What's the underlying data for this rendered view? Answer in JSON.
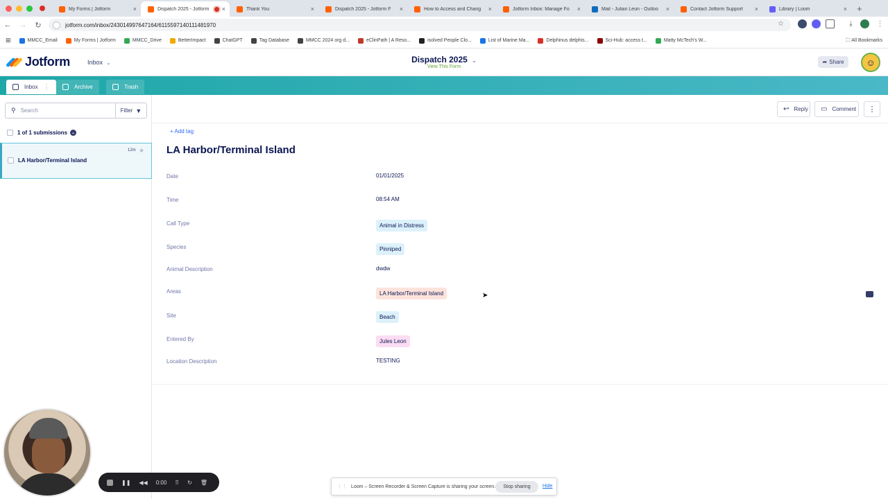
{
  "browser": {
    "tabs": [
      {
        "title": "My Forms | Jotform",
        "color": "#ff6100",
        "active": false
      },
      {
        "title": "Dispatch 2025 - Jotform",
        "color": "#ff6100",
        "active": true
      },
      {
        "title": "Thank You",
        "color": "#ff6100",
        "active": false
      },
      {
        "title": "Dispatch 2025 - Jotform F",
        "color": "#ff6100",
        "active": false
      },
      {
        "title": "How to Access and Chang",
        "color": "#ff6100",
        "active": false
      },
      {
        "title": "Jotform Inbox: Manage Fo",
        "color": "#ff6100",
        "active": false
      },
      {
        "title": "Mail - Julian Leon - Outloo",
        "color": "#0f6cbd",
        "active": false
      },
      {
        "title": "Contact Jotform Support",
        "color": "#ff6100",
        "active": false
      },
      {
        "title": "Library | Loom",
        "color": "#625df5",
        "active": false
      }
    ],
    "url": "jotform.com/inbox/243014997647164/6115597140111481970",
    "bookmarks": [
      {
        "label": "MMCC_Email",
        "color": "#1a73e8"
      },
      {
        "label": "My Forms | Jotform",
        "color": "#ff6100"
      },
      {
        "label": "MMCC_Drive",
        "color": "#34a853"
      },
      {
        "label": "BetterImpact",
        "color": "#f2a900"
      },
      {
        "label": "ChatGPT",
        "color": "#444"
      },
      {
        "label": "Tag Database",
        "color": "#444"
      },
      {
        "label": "MMCC 2024 org d...",
        "color": "#444"
      },
      {
        "label": "eClinPath | A Reso...",
        "color": "#c0392b"
      },
      {
        "label": "isolved People Clo...",
        "color": "#222"
      },
      {
        "label": "List of Marine Ma...",
        "color": "#1a73e8"
      },
      {
        "label": "Delphinus delphis...",
        "color": "#d93025"
      },
      {
        "label": "Sci-Hub: access t...",
        "color": "#8b0000"
      },
      {
        "label": "Matty McTech's W...",
        "color": "#34a853"
      }
    ],
    "all_bookmarks": "All Bookmarks"
  },
  "header": {
    "logo": "Jotform",
    "inbox_dropdown": "Inbox",
    "form_title": "Dispatch 2025",
    "form_link": "View This Form",
    "share": "Share"
  },
  "tabs": {
    "inbox": "Inbox",
    "archive": "Archive",
    "trash": "Trash"
  },
  "sidebar": {
    "search_placeholder": "Search",
    "filter": "Filter",
    "count": "1 of 1 submissions",
    "items": [
      {
        "name": "LA Harbor/Terminal Island",
        "time": "12m"
      }
    ]
  },
  "toolbar": {
    "reply": "Reply",
    "comment": "Comment"
  },
  "submission": {
    "add_tag": "+ Add tag",
    "title": "LA Harbor/Terminal Island",
    "fields": [
      {
        "label": "Date",
        "value": "01/01/2025",
        "chip": false,
        "color": ""
      },
      {
        "label": "Time",
        "value": "08:54 AM",
        "chip": false,
        "color": ""
      },
      {
        "label": "Call Type",
        "value": "Animal in Distress",
        "chip": true,
        "color": "#dcf1fb"
      },
      {
        "label": "Species",
        "value": "Pinniped",
        "chip": true,
        "color": "#dcf1fb"
      },
      {
        "label": "Animal Description",
        "value": "dwdw",
        "chip": false,
        "color": ""
      },
      {
        "label": "Areas",
        "value": "LA Harbor/Terminal Island",
        "chip": true,
        "color": "#fde3dc"
      },
      {
        "label": "Site",
        "value": "Beach",
        "chip": true,
        "color": "#dcf1fb"
      },
      {
        "label": "Entered By",
        "value": "Jules Leon",
        "chip": true,
        "color": "#fbdcf3"
      },
      {
        "label": "Location Description",
        "value": "TESTING",
        "chip": false,
        "color": ""
      }
    ]
  },
  "loom": {
    "timer": "0:00",
    "banner_text": "Loom – Screen Recorder & Screen Capture is sharing your screen.",
    "stop_sharing": "Stop sharing",
    "hide": "Hide"
  }
}
